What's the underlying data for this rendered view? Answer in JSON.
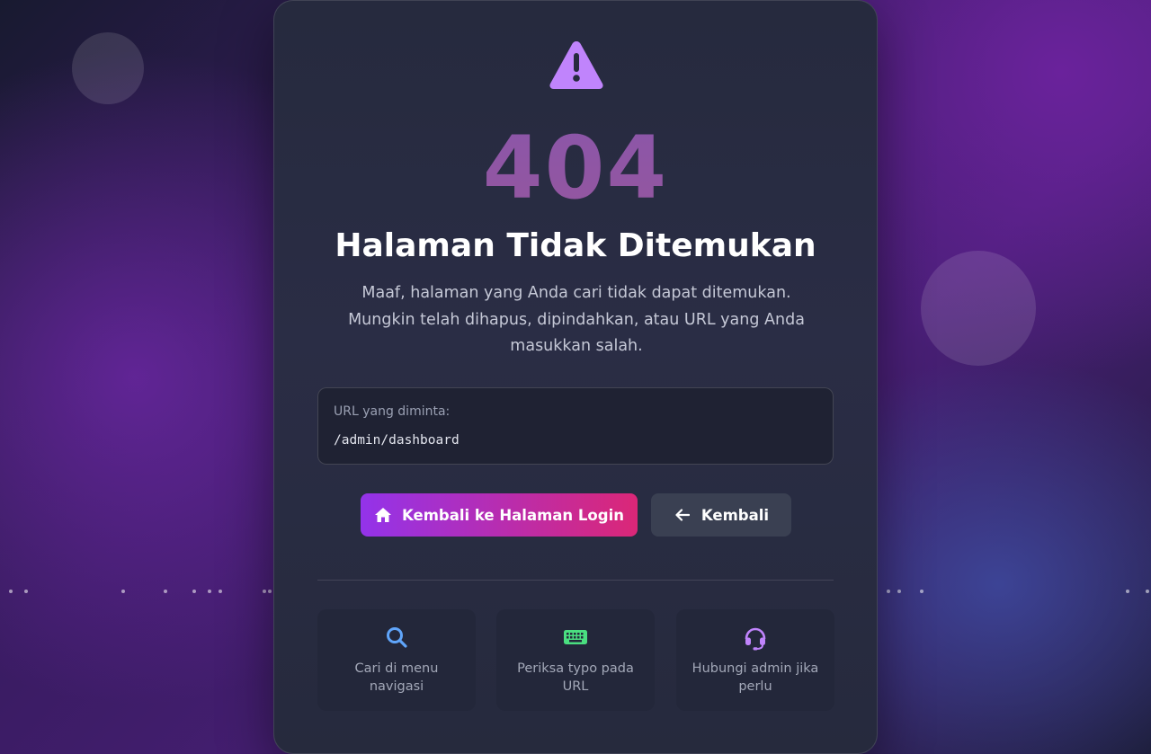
{
  "error": {
    "code": "404",
    "title": "Halaman Tidak Ditemukan",
    "description": "Maaf, halaman yang Anda cari tidak dapat ditemukan. Mungkin telah dihapus, dipindahkan, atau URL yang Anda masukkan salah."
  },
  "url_box": {
    "label": "URL yang diminta:",
    "value": "/admin/dashboard"
  },
  "actions": {
    "login_label": "Kembali ke Halaman Login",
    "back_label": "Kembali"
  },
  "tips": [
    {
      "icon": "search-icon",
      "text": "Cari di menu navigasi"
    },
    {
      "icon": "keyboard-icon",
      "text": "Periksa typo pada URL"
    },
    {
      "icon": "headset-icon",
      "text": "Hubungi admin jika perlu"
    }
  ],
  "colors": {
    "warning_icon": "#c084fc",
    "code_text": "#8e57a9",
    "primary_gradient_start": "#9333ea",
    "primary_gradient_end": "#db2777",
    "secondary_button": "#3a4052",
    "search_icon": "#60a5fa",
    "keyboard_icon": "#4ade80",
    "headset_icon": "#c084fc"
  }
}
